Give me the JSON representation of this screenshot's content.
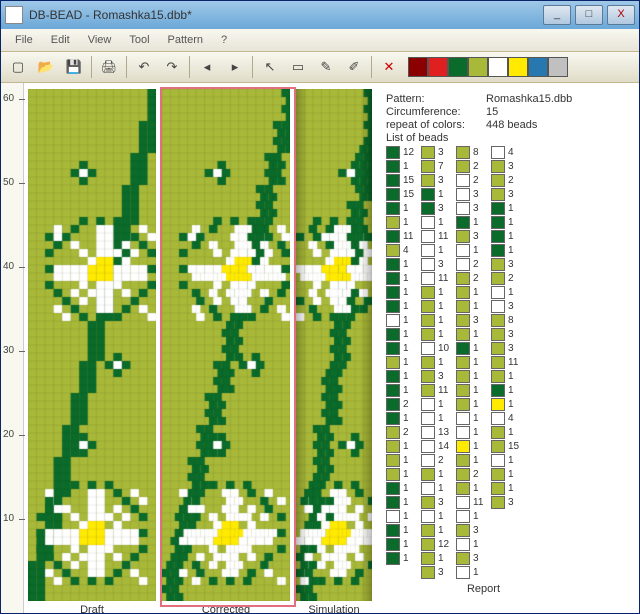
{
  "window": {
    "title": "DB-BEAD - Romashka15.dbb*",
    "min": "_",
    "max": "□",
    "close": "X"
  },
  "menu": {
    "file": "File",
    "edit": "Edit",
    "view": "View",
    "tool": "Tool",
    "pattern": "Pattern",
    "help": "?"
  },
  "ruler": {
    "ticks": [
      60,
      50,
      40,
      30,
      20,
      10
    ]
  },
  "panels": {
    "draft": "Draft",
    "corrected": "Corrected",
    "simulation": "Simulation",
    "report": "Report"
  },
  "palette": [
    "#8b0000",
    "#e02020",
    "#0a6b2a",
    "#a8b838",
    "#ffffff",
    "#ffea00",
    "#2878b0",
    "#c0c0c0"
  ],
  "info": {
    "pattern_k": "Pattern:",
    "pattern_v": "Romashka15.dbb",
    "circ_k": "Circumference:",
    "circ_v": "15",
    "rep_k": "repeat of colors:",
    "rep_v": "448 beads",
    "list_k": "List of beads"
  },
  "colors": {
    "dg": "#0a6b2a",
    "og": "#a8b838",
    "wh": "#ffffff",
    "ye": "#ffea00"
  },
  "bead_columns": [
    [
      [
        "dg",
        12
      ],
      [
        "dg",
        1
      ],
      [
        "dg",
        15
      ],
      [
        "dg",
        15
      ],
      [
        "dg",
        1
      ],
      [
        "og",
        1
      ],
      [
        "dg",
        11
      ],
      [
        "og",
        4
      ],
      [
        "dg",
        1
      ],
      [
        "dg",
        1
      ],
      [
        "dg",
        1
      ],
      [
        "dg",
        1
      ],
      [
        "wh",
        1
      ],
      [
        "dg",
        1
      ],
      [
        "dg",
        1
      ],
      [
        "og",
        1
      ],
      [
        "dg",
        1
      ],
      [
        "dg",
        1
      ],
      [
        "dg",
        2
      ],
      [
        "dg",
        1
      ],
      [
        "og",
        2
      ],
      [
        "og",
        1
      ],
      [
        "og",
        1
      ],
      [
        "og",
        1
      ],
      [
        "dg",
        1
      ],
      [
        "dg",
        1
      ],
      [
        "wh",
        1
      ],
      [
        "dg",
        1
      ],
      [
        "dg",
        1
      ],
      [
        "dg",
        1
      ]
    ],
    [
      [
        "og",
        3
      ],
      [
        "og",
        7
      ],
      [
        "og",
        3
      ],
      [
        "dg",
        1
      ],
      [
        "dg",
        3
      ],
      [
        "wh",
        1
      ],
      [
        "wh",
        11
      ],
      [
        "wh",
        1
      ],
      [
        "wh",
        3
      ],
      [
        "wh",
        11
      ],
      [
        "og",
        1
      ],
      [
        "og",
        1
      ],
      [
        "og",
        1
      ],
      [
        "og",
        1
      ],
      [
        "wh",
        10
      ],
      [
        "og",
        1
      ],
      [
        "og",
        3
      ],
      [
        "og",
        11
      ],
      [
        "wh",
        1
      ],
      [
        "wh",
        1
      ],
      [
        "wh",
        13
      ],
      [
        "wh",
        14
      ],
      [
        "wh",
        2
      ],
      [
        "og",
        1
      ],
      [
        "wh",
        1
      ],
      [
        "og",
        3
      ],
      [
        "wh",
        1
      ],
      [
        "og",
        1
      ],
      [
        "og",
        12
      ],
      [
        "og",
        1
      ],
      [
        "og",
        3
      ]
    ],
    [
      [
        "og",
        8
      ],
      [
        "og",
        2
      ],
      [
        "wh",
        2
      ],
      [
        "wh",
        3
      ],
      [
        "wh",
        3
      ],
      [
        "dg",
        1
      ],
      [
        "og",
        3
      ],
      [
        "wh",
        1
      ],
      [
        "wh",
        2
      ],
      [
        "og",
        2
      ],
      [
        "og",
        1
      ],
      [
        "og",
        1
      ],
      [
        "og",
        3
      ],
      [
        "og",
        1
      ],
      [
        "dg",
        1
      ],
      [
        "og",
        1
      ],
      [
        "og",
        1
      ],
      [
        "og",
        1
      ],
      [
        "og",
        1
      ],
      [
        "wh",
        1
      ],
      [
        "wh",
        1
      ],
      [
        "ye",
        1
      ],
      [
        "og",
        1
      ],
      [
        "og",
        2
      ],
      [
        "og",
        1
      ],
      [
        "wh",
        11
      ],
      [
        "wh",
        1
      ],
      [
        "og",
        3
      ],
      [
        "wh",
        1
      ],
      [
        "og",
        3
      ],
      [
        "wh",
        1
      ]
    ],
    [
      [
        "wh",
        4
      ],
      [
        "og",
        3
      ],
      [
        "og",
        2
      ],
      [
        "og",
        3
      ],
      [
        "dg",
        1
      ],
      [
        "dg",
        1
      ],
      [
        "dg",
        1
      ],
      [
        "dg",
        1
      ],
      [
        "og",
        3
      ],
      [
        "og",
        2
      ],
      [
        "wh",
        1
      ],
      [
        "wh",
        3
      ],
      [
        "og",
        8
      ],
      [
        "og",
        3
      ],
      [
        "og",
        3
      ],
      [
        "og",
        11
      ],
      [
        "og",
        1
      ],
      [
        "dg",
        1
      ],
      [
        "ye",
        1
      ],
      [
        "wh",
        4
      ],
      [
        "og",
        1
      ],
      [
        "og",
        15
      ],
      [
        "wh",
        1
      ],
      [
        "og",
        1
      ],
      [
        "og",
        1
      ],
      [
        "og",
        3
      ]
    ]
  ]
}
